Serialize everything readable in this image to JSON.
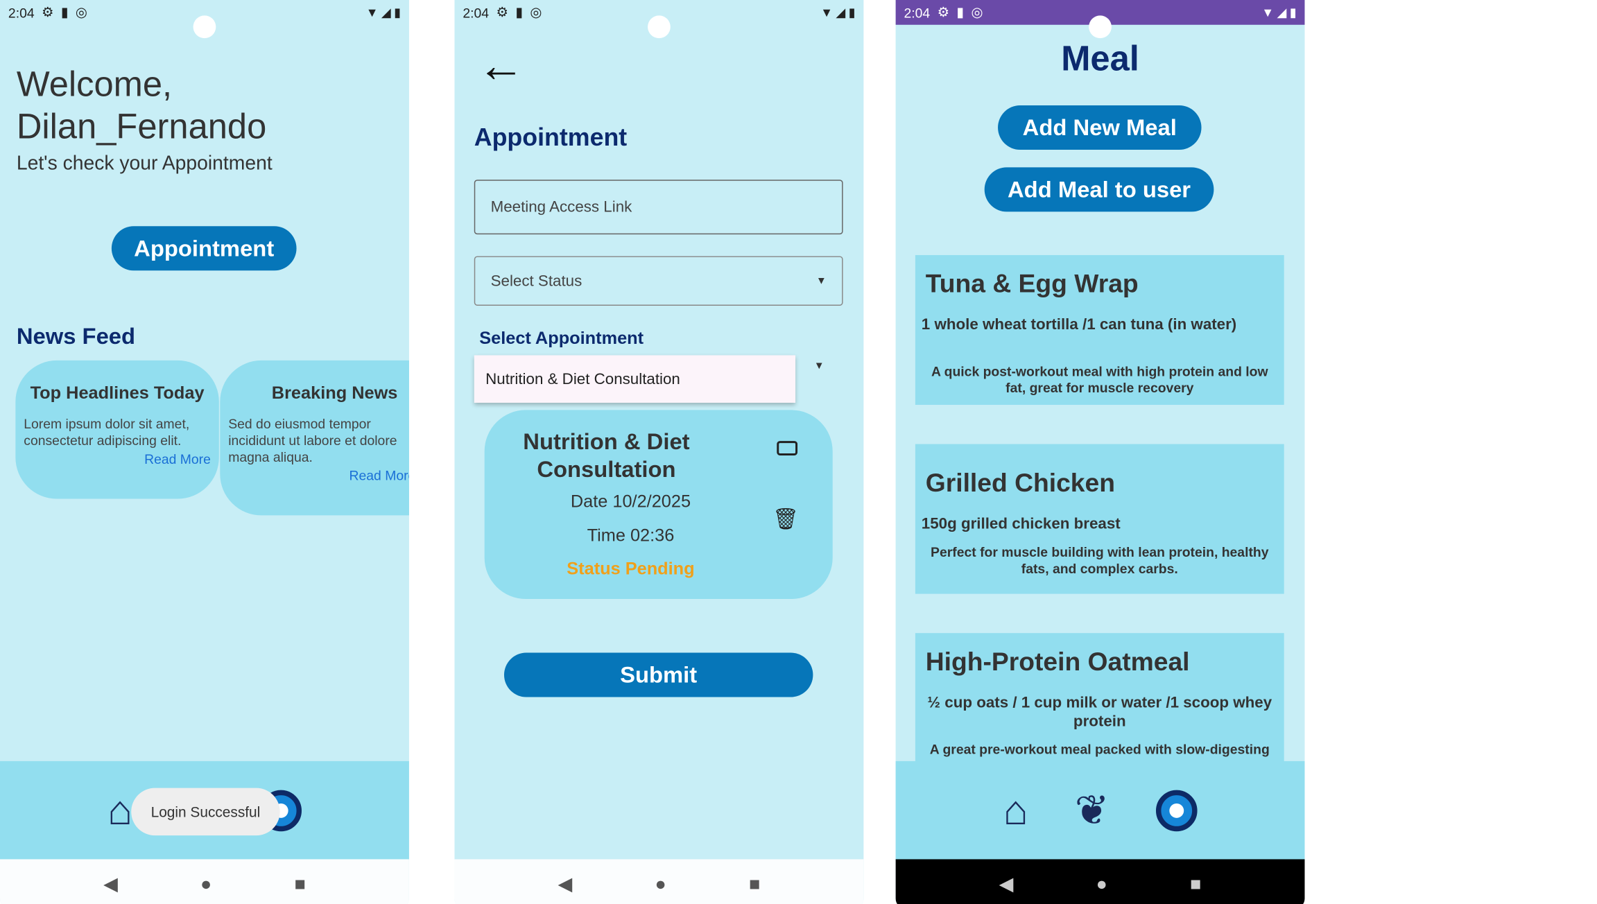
{
  "status_bar": {
    "time": "2:04"
  },
  "home": {
    "welcome": "Welcome,",
    "username": "Dilan_Fernando",
    "subtitle": "Let's check your Appointment",
    "appointment_button": "Appointment",
    "news_feed_title": "News Feed",
    "news": [
      {
        "title": "Top Headlines Today",
        "body": "Lorem ipsum dolor sit amet, consectetur adipiscing elit.",
        "link": "Read More"
      },
      {
        "title": "Breaking News",
        "body": "Sed do eiusmod tempor incididunt ut labore et dolore magna aliqua.",
        "link": "Read More"
      }
    ],
    "toast": "Login Successful"
  },
  "appointment": {
    "title": "Appointment",
    "meeting_link_placeholder": "Meeting Access Link",
    "status_placeholder": "Select Status",
    "select_appointment_label": "Select Appointment",
    "dropdown_option": "Nutrition & Diet Consultation",
    "card": {
      "title": "Nutrition & Diet Consultation",
      "date": "Date 10/2/2025",
      "time": "Time 02:36",
      "status": "Status Pending",
      "status_color": "#f0a01a"
    },
    "submit_button": "Submit"
  },
  "meal": {
    "title": "Meal",
    "add_new_button": "Add New Meal",
    "add_to_user_button": "Add Meal to user",
    "items": [
      {
        "name": "Tuna & Egg Wrap",
        "ingredients": "1 whole wheat tortilla /1 can tuna (in water)",
        "description": "A quick post-workout meal with high protein and low fat, great for muscle recovery"
      },
      {
        "name": "Grilled Chicken",
        "ingredients": "150g grilled chicken breast",
        "description": "Perfect for muscle building with lean protein, healthy fats, and complex carbs."
      },
      {
        "name": "High-Protein Oatmeal",
        "ingredients": "½ cup oats / 1 cup milk or water /1 scoop whey protein",
        "description": "A great pre-workout meal packed with slow-digesting"
      }
    ]
  },
  "colors": {
    "background": "#c8eef6",
    "card": "#92deef",
    "primary": "#0676b9",
    "heading": "#0c2a6e"
  },
  "icons": [
    "home-icon",
    "food-icon",
    "settings-icon",
    "video-icon",
    "trash-icon",
    "back-arrow-icon"
  ]
}
